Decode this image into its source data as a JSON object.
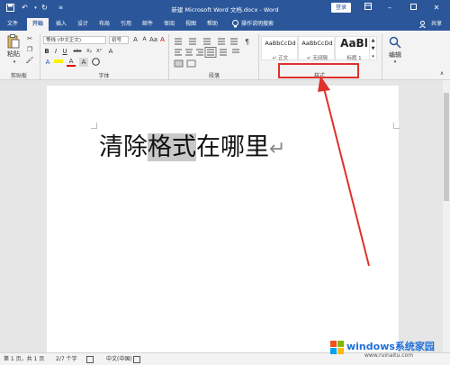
{
  "titlebar": {
    "doc_title": "新建 Microsoft Word 文档.docx - Word",
    "login_label": "登录",
    "icons": [
      "save-icon",
      "undo-icon",
      "redo-icon",
      "customize-icon",
      "ribbon-display-icon",
      "minimize-icon",
      "restore-icon",
      "close-icon"
    ]
  },
  "tabs": {
    "items": [
      "文件",
      "开始",
      "插入",
      "设计",
      "布局",
      "引用",
      "邮件",
      "审阅",
      "视图",
      "帮助"
    ],
    "active": "开始",
    "tell_me": "操作说明搜索",
    "share": "共享"
  },
  "ribbon": {
    "clipboard": {
      "paste_label": "粘贴",
      "group_label": "剪贴板"
    },
    "font": {
      "font_name": "等线 (中文正文)",
      "font_size": "初号",
      "group_label": "字体",
      "buttons": [
        "B",
        "I",
        "U",
        "abc",
        "X₂",
        "X²",
        "A",
        "A",
        "A",
        "Aa",
        "A",
        "A"
      ]
    },
    "paragraph": {
      "group_label": "段落"
    },
    "styles": {
      "group_label": "样式",
      "cards": [
        {
          "sample": "AaBbCcDd",
          "label": "↵ 正文"
        },
        {
          "sample": "AaBbCcDd",
          "label": "↵ 无间隔"
        },
        {
          "sample": "AaBl",
          "label": "标题 1"
        }
      ]
    },
    "editing": {
      "label": "编辑"
    }
  },
  "document": {
    "text_before": "清除",
    "text_highlight": "格式",
    "text_after": "在哪里",
    "pilcrow": "↵"
  },
  "statusbar": {
    "page": "第 1 页，共 1 页",
    "words": "2/7 个字",
    "language": "中文(中国)"
  },
  "watermark": {
    "brand": "windows系统家园",
    "url": "www.ruinaitu.com"
  },
  "colors": {
    "word_blue": "#2b579a",
    "annotation_red": "#e0302b"
  }
}
